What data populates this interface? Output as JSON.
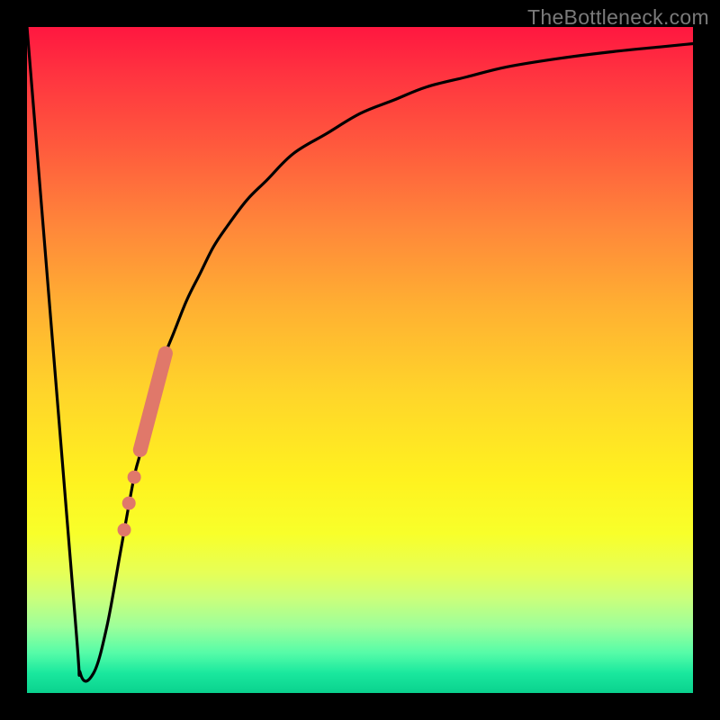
{
  "watermark": "TheBottleneck.com",
  "colors": {
    "curve": "#000000",
    "marker": "#e0786a",
    "frame": "#000000"
  },
  "chart_data": {
    "type": "line",
    "title": "",
    "xlabel": "",
    "ylabel": "",
    "xlim": [
      0,
      100
    ],
    "ylim": [
      0,
      100
    ],
    "grid": false,
    "legend": false,
    "series": [
      {
        "name": "bottleneck-curve",
        "x": [
          0,
          7,
          8,
          10,
          12,
          14,
          16,
          17,
          18,
          19,
          20,
          22,
          24,
          26,
          28,
          30,
          33,
          36,
          40,
          45,
          50,
          55,
          60,
          66,
          72,
          80,
          88,
          95,
          100
        ],
        "y": [
          100,
          14,
          3,
          3,
          10,
          21,
          32,
          36,
          41,
          45,
          49,
          54,
          59,
          63,
          67,
          70,
          74,
          77,
          81,
          84,
          87,
          89,
          91,
          92.5,
          94,
          95.3,
          96.3,
          97,
          97.5
        ]
      }
    ],
    "markers": {
      "dots": [
        {
          "x": 14.6,
          "y": 24.5
        },
        {
          "x": 15.3,
          "y": 28.5
        },
        {
          "x": 16.1,
          "y": 32.4
        }
      ],
      "thick_segment": {
        "x": [
          17.0,
          20.8
        ],
        "y": [
          36.5,
          51.0
        ]
      }
    }
  }
}
